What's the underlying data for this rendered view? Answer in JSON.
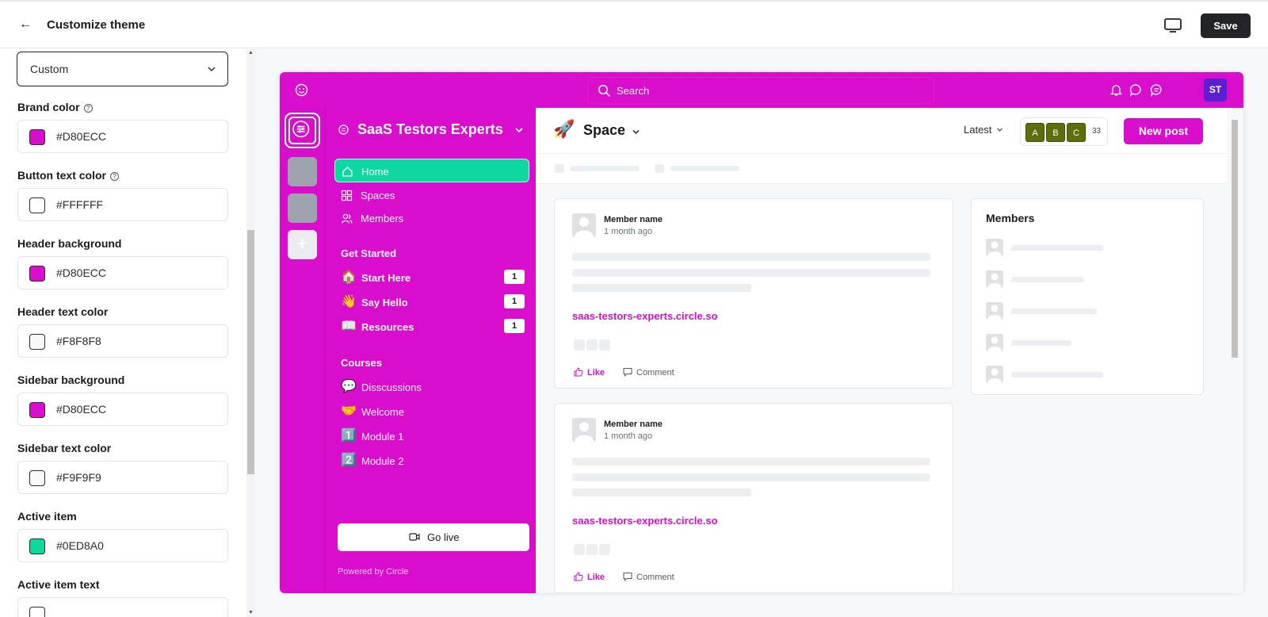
{
  "header": {
    "title": "Customize theme",
    "save_label": "Save"
  },
  "theme_panel": {
    "preset": "Custom",
    "fields": [
      {
        "label": "Brand color",
        "value": "#D80ECC",
        "help": true,
        "swatch": "#d80ecc"
      },
      {
        "label": "Button text color",
        "value": "#FFFFFF",
        "help": true,
        "swatch": "#ffffff"
      },
      {
        "label": "Header background",
        "value": "#D80ECC",
        "help": false,
        "swatch": "#d80ecc"
      },
      {
        "label": "Header text color",
        "value": "#F8F8F8",
        "help": false,
        "swatch": "#f8f8f8"
      },
      {
        "label": "Sidebar background",
        "value": "#D80ECC",
        "help": false,
        "swatch": "#d80ecc"
      },
      {
        "label": "Sidebar text color",
        "value": "#F9F9F9",
        "help": false,
        "swatch": "#f9f9f9"
      },
      {
        "label": "Active item",
        "value": "#0ED8A0",
        "help": false,
        "swatch": "#0ed8a0"
      },
      {
        "label": "Active item text",
        "value": "",
        "help": false,
        "swatch": "#ffffff"
      }
    ]
  },
  "preview": {
    "search_placeholder": "Search",
    "user_initials": "ST",
    "community_name": "SaaS Testors Experts",
    "nav": [
      {
        "label": "Home",
        "icon": "home-icon",
        "active": true
      },
      {
        "label": "Spaces",
        "icon": "grid-icon",
        "active": false
      },
      {
        "label": "Members",
        "icon": "users-icon",
        "active": false
      }
    ],
    "sections": [
      {
        "title": "Get Started",
        "channels": [
          {
            "emoji": "🏠",
            "label": "Start Here",
            "count": "1"
          },
          {
            "emoji": "👋",
            "label": "Say Hello",
            "count": "1"
          },
          {
            "emoji": "📖",
            "label": "Resources",
            "count": "1"
          }
        ]
      },
      {
        "title": "Courses",
        "channels": [
          {
            "emoji": "💬",
            "label": "Disscussions"
          },
          {
            "emoji": "🤝",
            "label": "Welcome"
          },
          {
            "emoji": "1️⃣",
            "label": "Module 1"
          },
          {
            "emoji": "2️⃣",
            "label": "Module 2"
          }
        ]
      }
    ],
    "go_live": "Go live",
    "powered_by": "Powered by Circle",
    "space": {
      "emoji": "🚀",
      "name": "Space",
      "sort": "Latest",
      "faces": [
        "A",
        "B",
        "C"
      ],
      "member_count": "33",
      "new_post": "New post"
    },
    "posts": [
      {
        "member": "Member name",
        "time": "1 month ago",
        "link": "saas-testors-experts.circle.so",
        "like": "Like",
        "comment": "Comment"
      },
      {
        "member": "Member name",
        "time": "1 month ago",
        "link": "saas-testors-experts.circle.so",
        "like": "Like",
        "comment": "Comment"
      }
    ],
    "members_title": "Members"
  },
  "colors": {
    "brand": "#D80ECC",
    "active": "#0ED8A0",
    "dark_button": "#222428"
  }
}
